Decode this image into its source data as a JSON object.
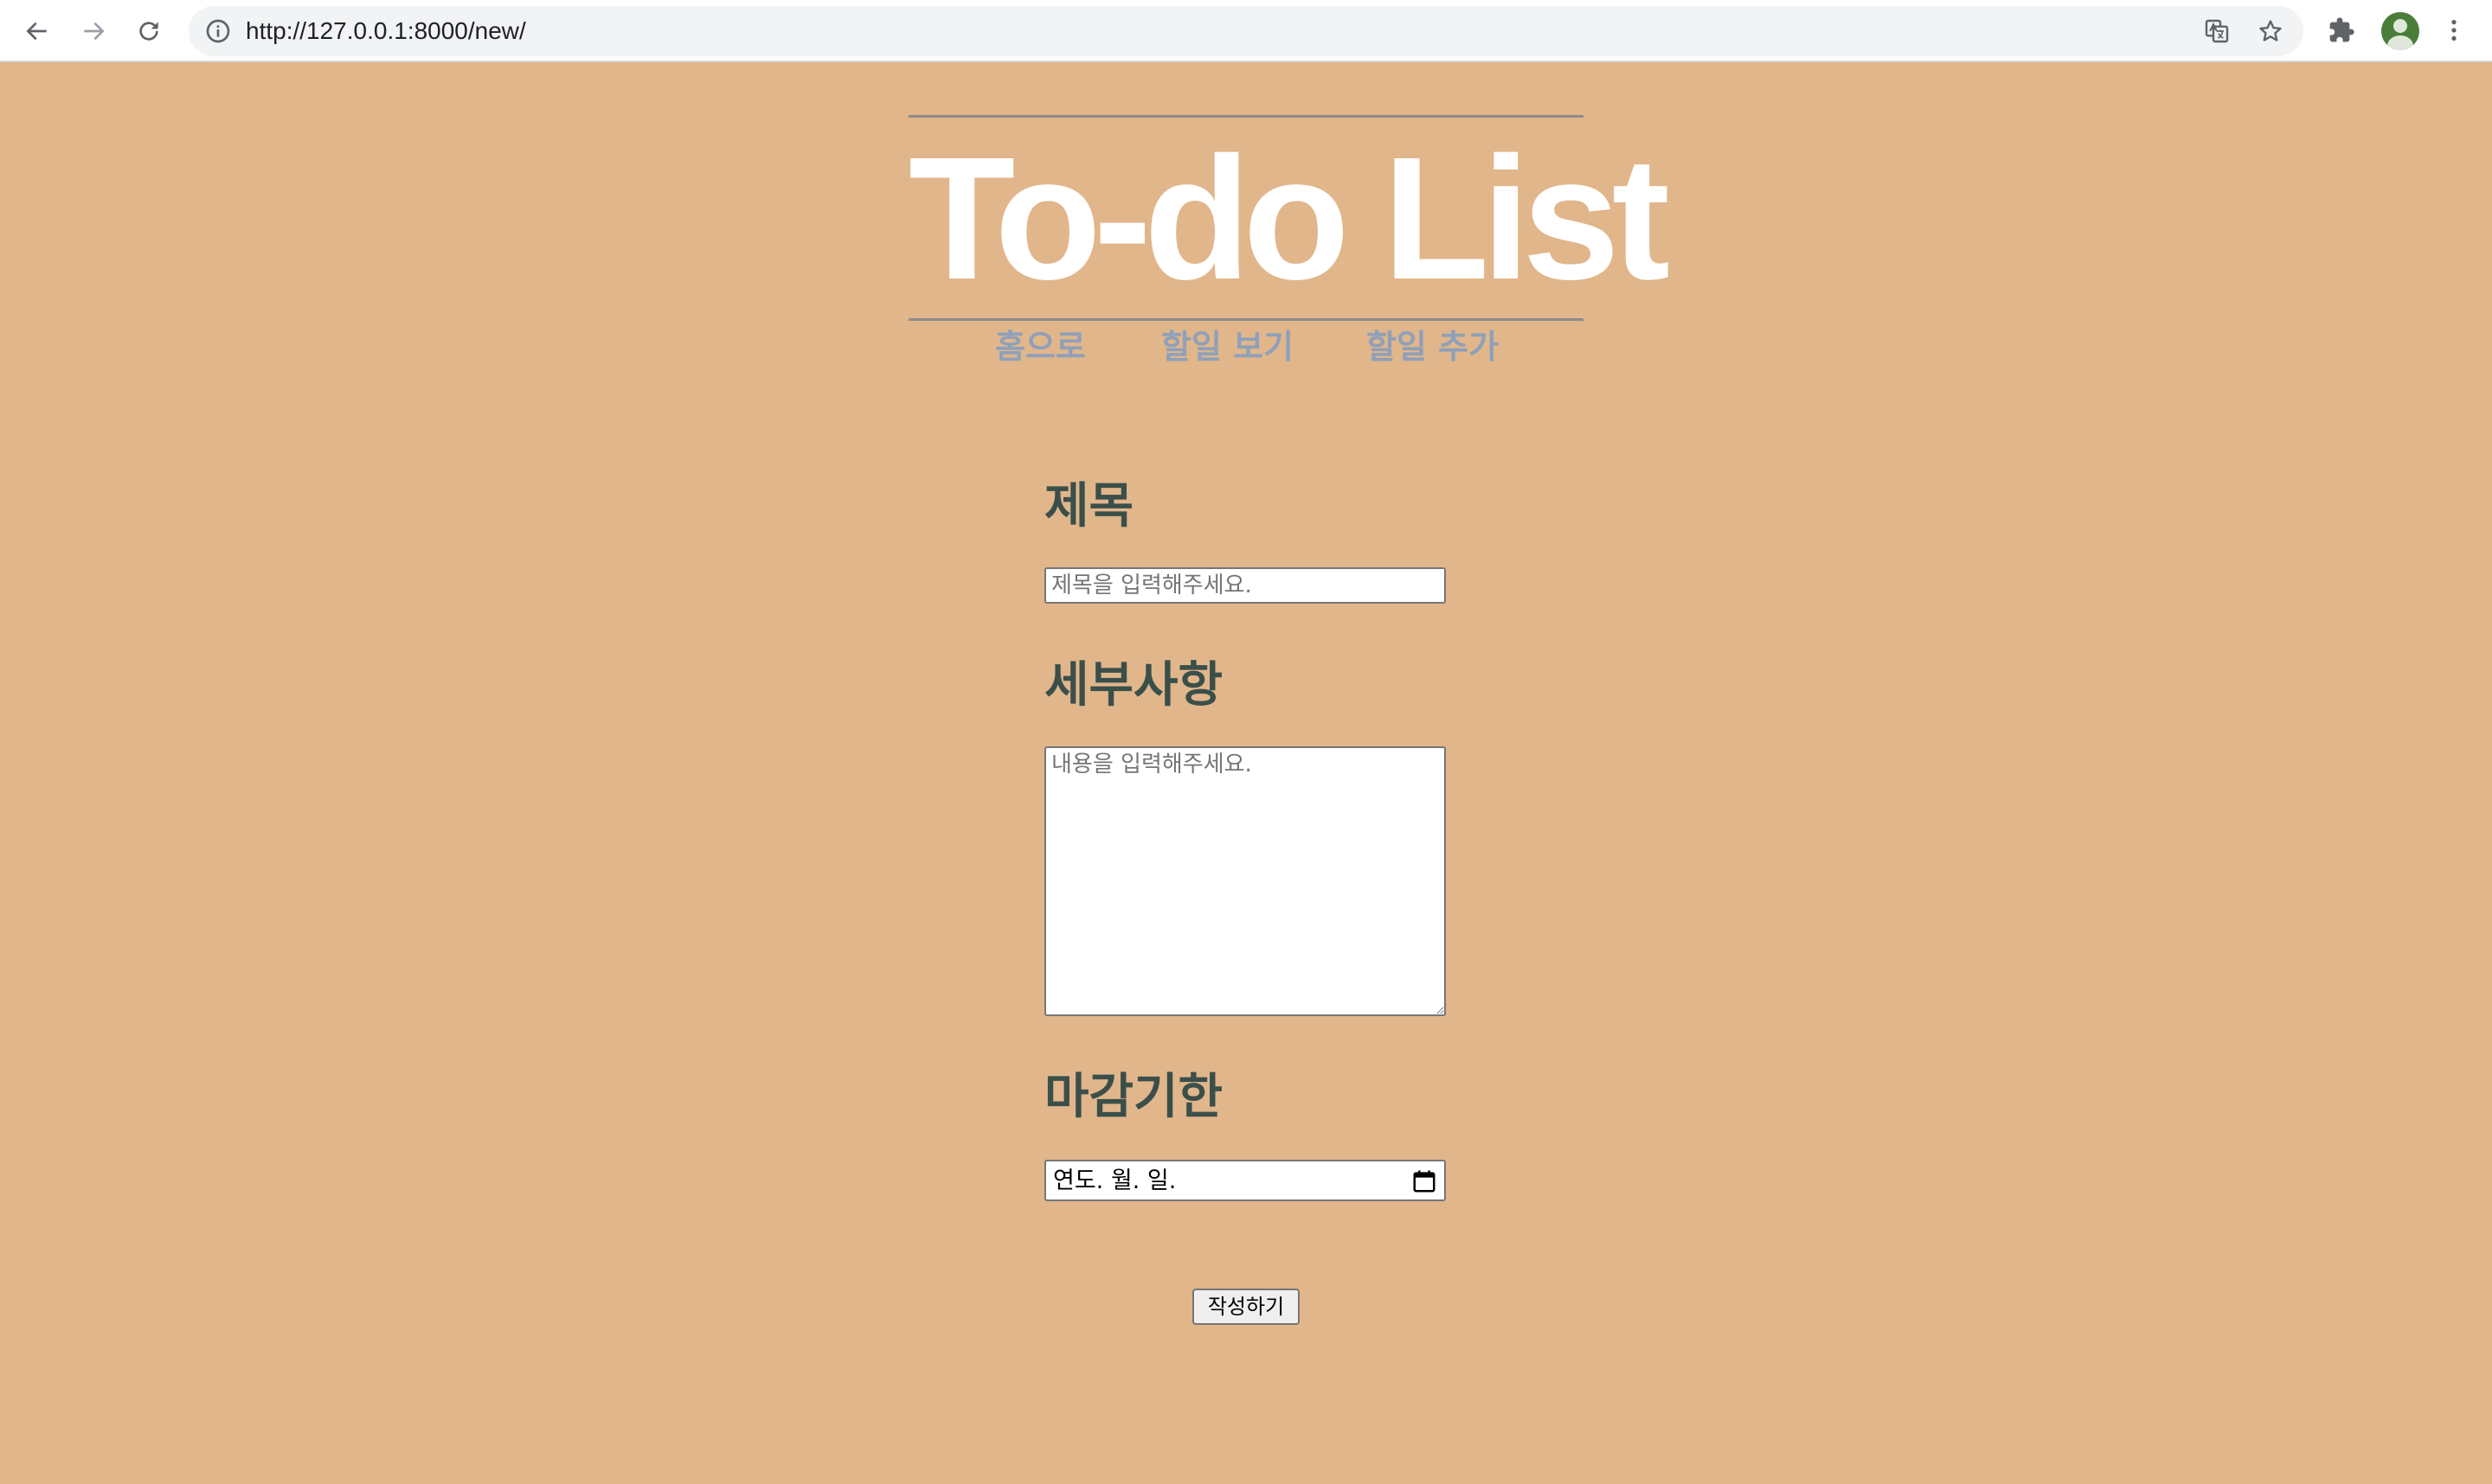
{
  "browser": {
    "url": "http://127.0.0.1:8000/new/"
  },
  "header": {
    "title": "To-do List",
    "nav": [
      {
        "label": "홈으로"
      },
      {
        "label": "할일 보기"
      },
      {
        "label": "할일 추가"
      }
    ]
  },
  "form": {
    "title_label": "제목",
    "title_placeholder": "제목을 입력해주세요.",
    "title_value": "",
    "detail_label": "세부사항",
    "detail_placeholder": "내용을 입력해주세요.",
    "detail_value": "",
    "deadline_label": "마감기한",
    "deadline_display": "연도. 월. 일.",
    "submit_label": "작성하기"
  },
  "colors": {
    "background": "#e1b68b",
    "title": "#ffffff",
    "nav_link": "#8fa0b9",
    "label": "#3b4f4a",
    "rule": "#8e8c8a"
  }
}
